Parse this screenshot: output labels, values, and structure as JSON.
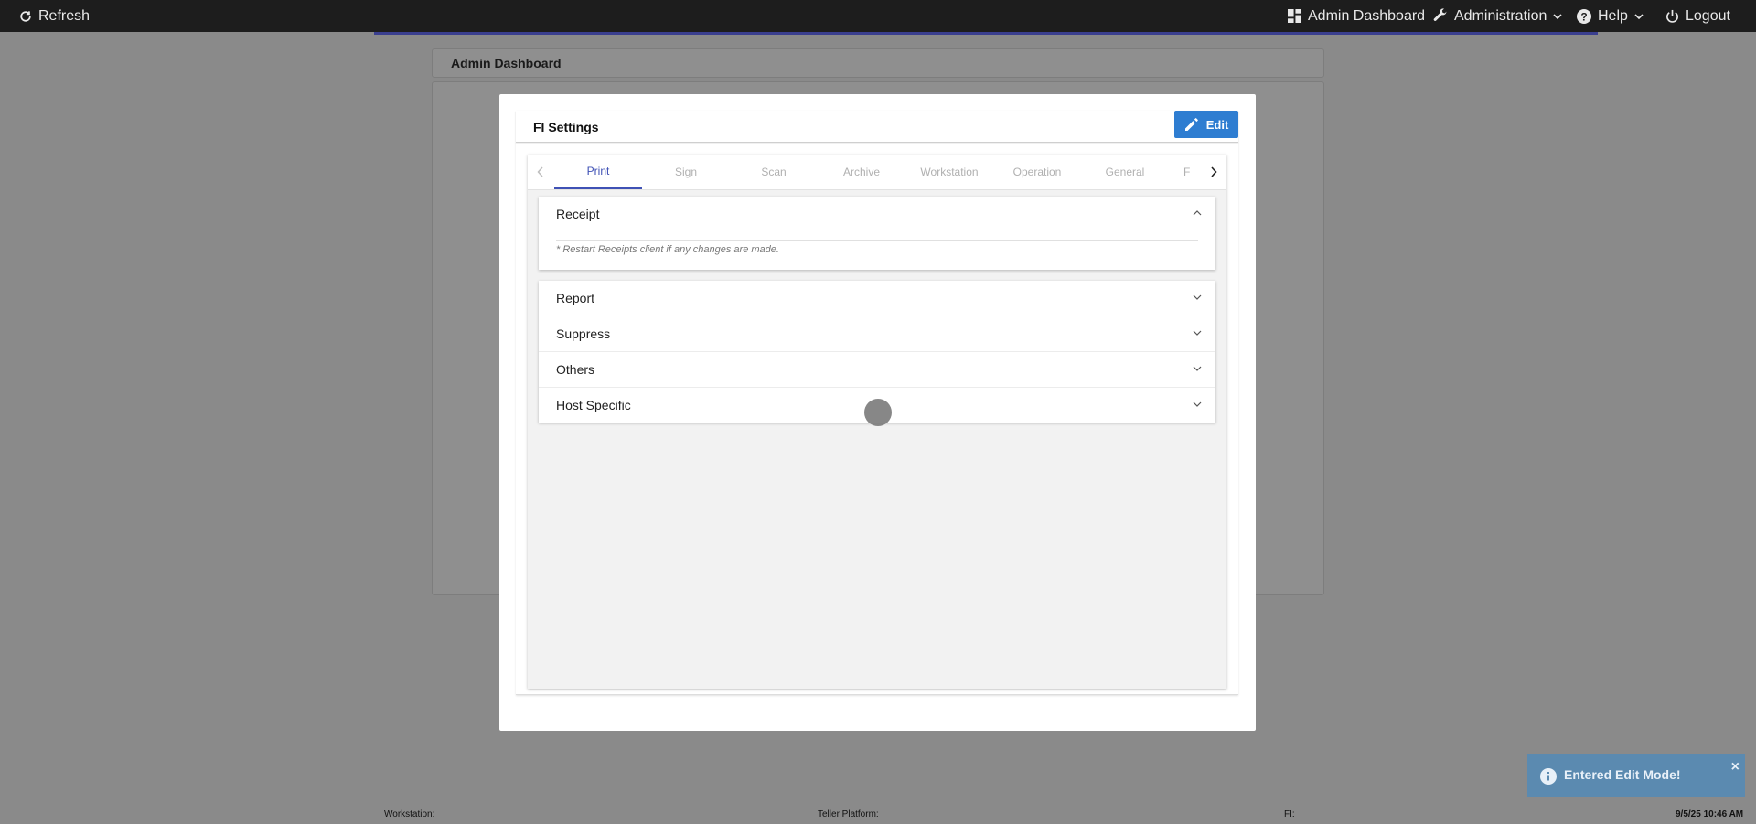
{
  "topbar": {
    "refresh_label": "Refresh",
    "admin_dashboard_label": "Admin Dashboard",
    "administration_label": "Administration",
    "help_label": "Help",
    "logout_label": "Logout"
  },
  "background": {
    "header_title": "Admin Dashboard"
  },
  "modal": {
    "title": "FI Settings",
    "edit_label": "Edit",
    "tabs": [
      {
        "label": "Print"
      },
      {
        "label": "Sign"
      },
      {
        "label": "Scan"
      },
      {
        "label": "Archive"
      },
      {
        "label": "Workstation"
      },
      {
        "label": "Operation"
      },
      {
        "label": "General"
      },
      {
        "label": "F"
      }
    ],
    "active_tab": "Print",
    "receipt": {
      "label": "Receipt",
      "note": "* Restart Receipts client if any changes are made."
    },
    "sections": [
      {
        "label": "Report"
      },
      {
        "label": "Suppress"
      },
      {
        "label": "Others"
      },
      {
        "label": "Host Specific"
      }
    ]
  },
  "toast": {
    "message": "Entered Edit Mode!",
    "close": "×"
  },
  "statusbar": {
    "workstation": "Workstation:",
    "teller_platform": "Teller Platform:",
    "fi": "FI:",
    "datetime": "9/5/25 10:46 AM"
  },
  "colors": {
    "accent": "#3f51b5",
    "edit_button": "#2e7dd1",
    "toast": "#5b8ab0"
  }
}
